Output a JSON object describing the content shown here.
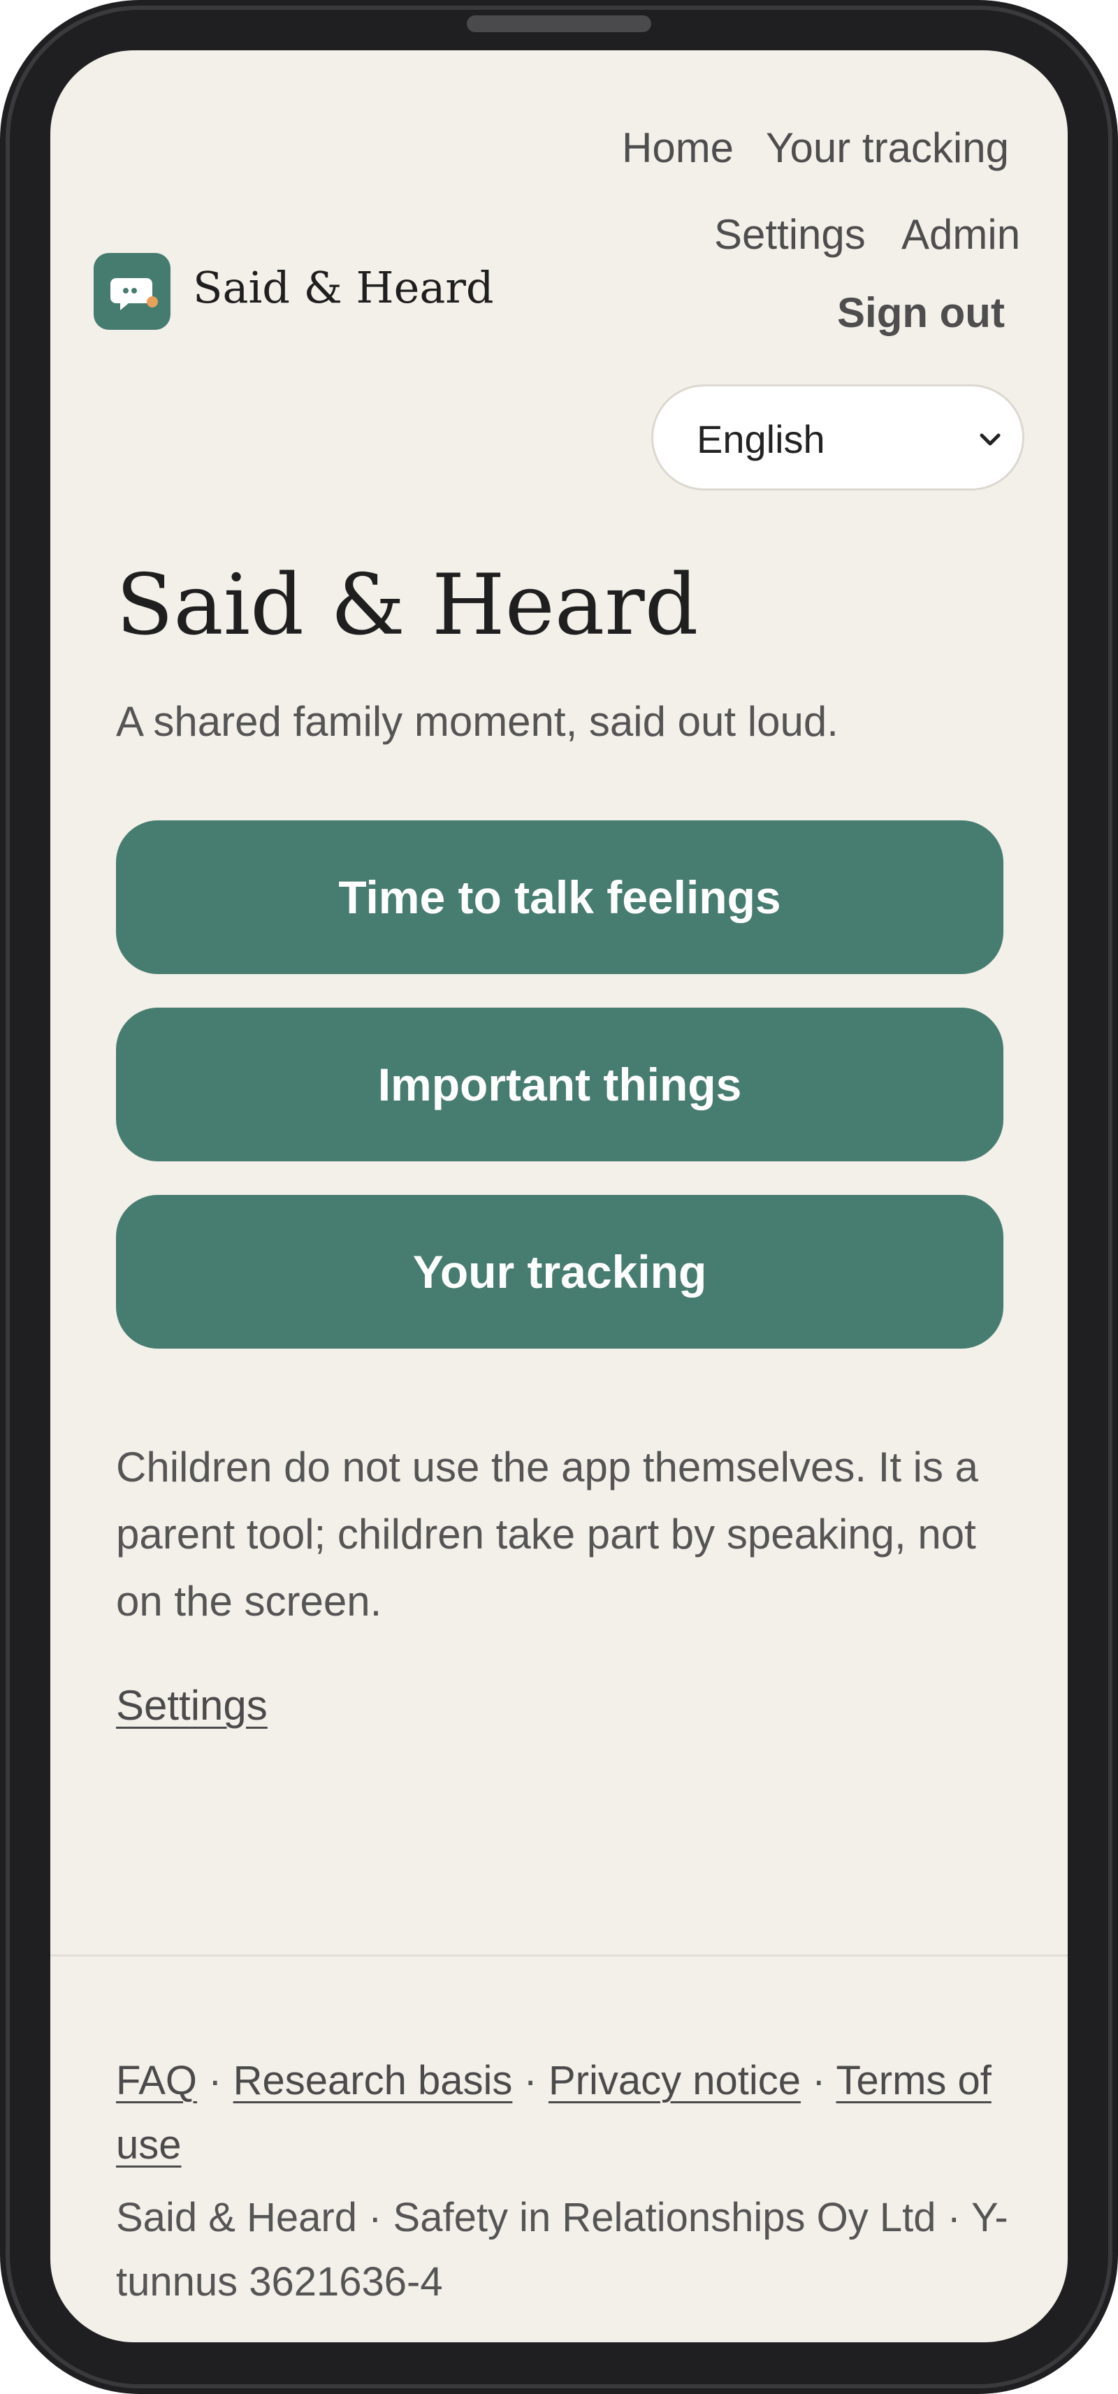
{
  "nav": {
    "home": "Home",
    "tracking": "Your tracking",
    "settings": "Settings",
    "admin": "Admin"
  },
  "brand": {
    "name": "Said & Heard"
  },
  "header": {
    "sign_out": "Sign out"
  },
  "language": {
    "selected": "English"
  },
  "main": {
    "title": "Said & Heard",
    "subtitle": "A shared family moment, said out loud.",
    "buttons": [
      {
        "label": "Time to talk feelings"
      },
      {
        "label": "Important things"
      },
      {
        "label": "Your tracking"
      }
    ],
    "note": "Children do not use the app themselves. It is a parent tool; children take part by speaking, not on the screen.",
    "settings_link": "Settings"
  },
  "footer": {
    "links": [
      "FAQ",
      "Research basis",
      "Privacy notice",
      "Terms of use"
    ],
    "separator": "·",
    "company": "Said & Heard · Safety in Relationships Oy Ltd · Y-tunnus 3621636-4"
  },
  "colors": {
    "accent": "#477c70",
    "background": "#f3f0ea",
    "device_frame": "#1f1f21"
  },
  "icons": {
    "logo": "speech-bubble-icon",
    "select": "chevron-down-icon"
  }
}
